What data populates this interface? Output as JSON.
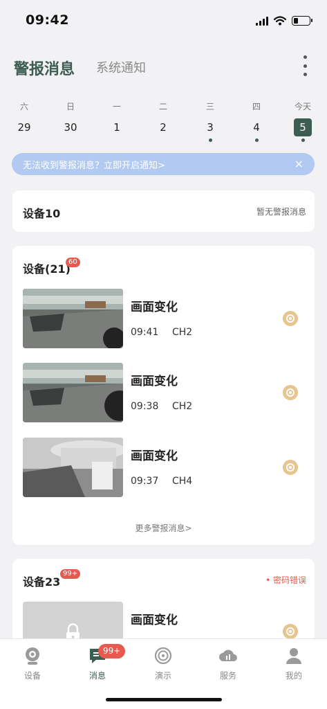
{
  "status": {
    "time": "09:42"
  },
  "header": {
    "tab_alerts": "警报消息",
    "tab_notices": "系统通知"
  },
  "week": [
    {
      "weekday": "六",
      "date": "29",
      "dot": false,
      "today": false
    },
    {
      "weekday": "日",
      "date": "30",
      "dot": false,
      "today": false
    },
    {
      "weekday": "一",
      "date": "1",
      "dot": false,
      "today": false
    },
    {
      "weekday": "二",
      "date": "2",
      "dot": false,
      "today": false
    },
    {
      "weekday": "三",
      "date": "3",
      "dot": true,
      "today": false
    },
    {
      "weekday": "四",
      "date": "4",
      "dot": true,
      "today": false
    },
    {
      "weekday": "今天",
      "date": "5",
      "dot": true,
      "today": true
    }
  ],
  "banner": {
    "text": "无法收到警报消息？立即开启通知>",
    "close": "×"
  },
  "device10": {
    "name": "设备10",
    "status": "暂无警报消息"
  },
  "device21": {
    "name": "设备(21)",
    "badge": "60",
    "alerts": [
      {
        "title": "画面变化",
        "time": "09:41",
        "channel": "CH2"
      },
      {
        "title": "画面变化",
        "time": "09:38",
        "channel": "CH2"
      },
      {
        "title": "画面变化",
        "time": "09:37",
        "channel": "CH4"
      }
    ],
    "more": "更多警报消息>"
  },
  "device23": {
    "name": "设备23",
    "badge": "99+",
    "error": "密码错误",
    "alert_title": "画面变化"
  },
  "tabbar": {
    "badge": "99+",
    "tabs": [
      {
        "label": "设备",
        "icon": "camera-icon",
        "active": false
      },
      {
        "label": "消息",
        "icon": "message-icon",
        "active": true
      },
      {
        "label": "演示",
        "icon": "demo-icon",
        "active": false
      },
      {
        "label": "服务",
        "icon": "cloud-icon",
        "active": false
      },
      {
        "label": "我的",
        "icon": "profile-icon",
        "active": false
      }
    ]
  },
  "colors": {
    "accent": "#3d5c52",
    "badge": "#e65a4f",
    "banner": "#b2c9f2",
    "play": "#e8c48f"
  }
}
